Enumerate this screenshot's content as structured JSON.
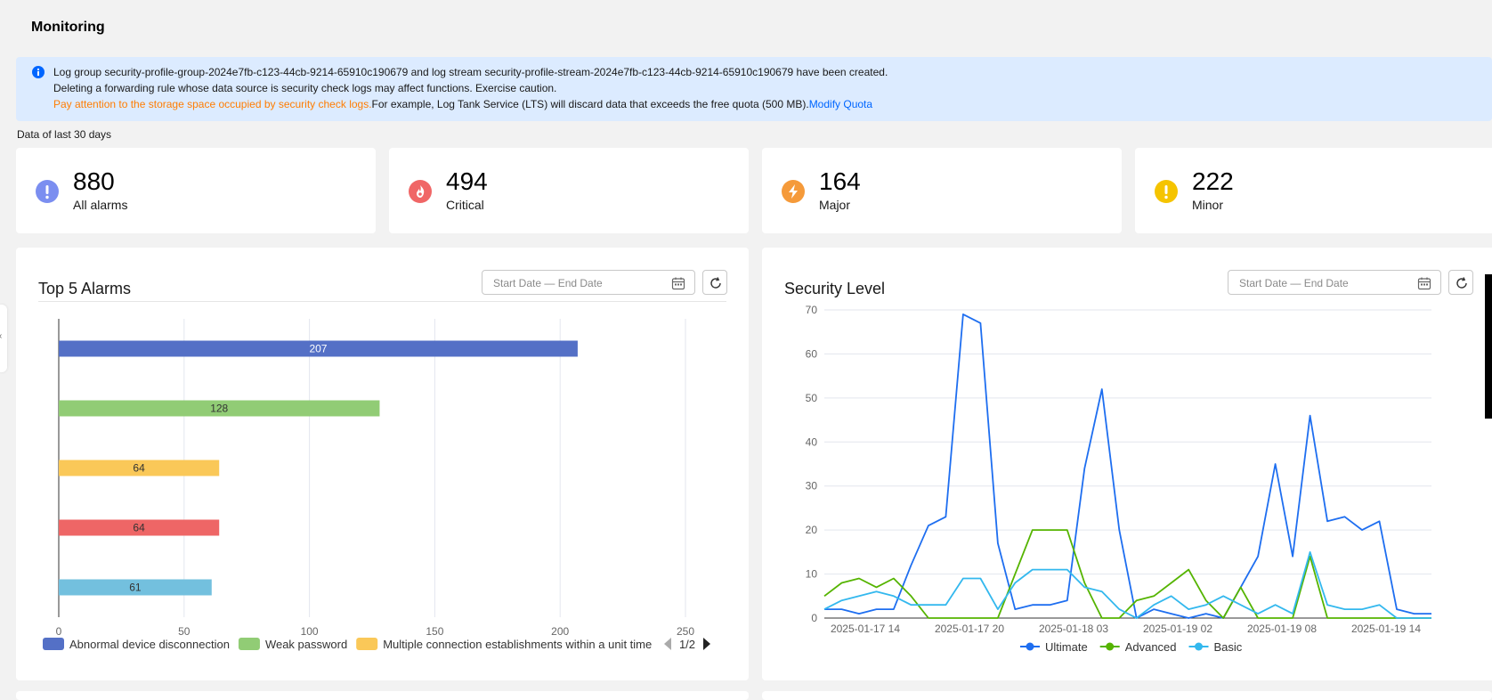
{
  "page": {
    "title": "Monitoring"
  },
  "notice": {
    "line1": "Log group security-profile-group-2024e7fb-c123-44cb-9214-65910c190679 and log stream security-profile-stream-2024e7fb-c123-44cb-9214-65910c190679 have been created.",
    "line2": "Deleting a forwarding rule whose data source is security check logs may affect functions. Exercise caution.",
    "warning": "Pay attention to the storage space occupied by security check logs.",
    "line3": "For example, Log Tank Service (LTS) will discard data that exceeds the free quota (500 MB).",
    "link": "Modify Quota",
    "icon": "info-icon"
  },
  "range_label": "Data of last 30 days",
  "stats": [
    {
      "value": "880",
      "label": "All alarms",
      "icon": "exclamation-icon",
      "color": "#7b8ef0"
    },
    {
      "value": "494",
      "label": "Critical",
      "icon": "flame-icon",
      "color": "#f06666"
    },
    {
      "value": "164",
      "label": "Major",
      "icon": "lightning-icon",
      "color": "#f59a3a"
    },
    {
      "value": "222",
      "label": "Minor",
      "icon": "exclamation-icon",
      "color": "#f5c400"
    }
  ],
  "top_alarms": {
    "title": "Top 5 Alarms",
    "date_placeholder": "Start Date — End Date",
    "pager": "1/2"
  },
  "security_level": {
    "title": "Security Level",
    "date_placeholder": "Start Date — End Date"
  },
  "chart_data": [
    {
      "type": "bar",
      "orientation": "horizontal",
      "title": "Top 5 Alarms",
      "categories": [
        "Abnormal device disconnection",
        "Weak password",
        "Multiple connection establishments within a unit time",
        "",
        ""
      ],
      "values": [
        207,
        128,
        64,
        64,
        61
      ],
      "colors": [
        "#5470c6",
        "#91cc75",
        "#fac858",
        "#ee6666",
        "#73c0de"
      ],
      "legend": [
        "Abnormal device disconnection",
        "Weak password",
        "Multiple connection establishments within a unit time"
      ],
      "xlim": [
        0,
        250
      ],
      "xticks": [
        0,
        50,
        100,
        150,
        200,
        250
      ],
      "grid": true,
      "legend_position": "bottom"
    },
    {
      "type": "line",
      "title": "Security Level",
      "x_ticks": [
        "2025-01-17 14",
        "2025-01-17 20",
        "2025-01-18 03",
        "2025-01-19 02",
        "2025-01-19 08",
        "2025-01-19 14"
      ],
      "ylim": [
        0,
        70
      ],
      "yticks": [
        0,
        10,
        20,
        30,
        40,
        50,
        60,
        70
      ],
      "grid": true,
      "legend_position": "bottom",
      "series": [
        {
          "name": "Ultimate",
          "color": "#1e6ef0",
          "values": [
            2,
            2,
            1,
            2,
            2,
            12,
            21,
            23,
            69,
            67,
            17,
            2,
            3,
            3,
            4,
            34,
            52,
            20,
            0,
            2,
            1,
            0,
            1,
            0,
            7,
            14,
            35,
            14,
            46,
            22,
            23,
            20,
            22,
            2,
            1,
            1
          ]
        },
        {
          "name": "Advanced",
          "color": "#55b400",
          "values": [
            5,
            8,
            9,
            7,
            9,
            5,
            0,
            0,
            0,
            0,
            0,
            10,
            20,
            20,
            20,
            8,
            0,
            0,
            4,
            5,
            8,
            11,
            4,
            0,
            7,
            0,
            0,
            0,
            14,
            0,
            0,
            0,
            0,
            0,
            0,
            0
          ]
        },
        {
          "name": "Basic",
          "color": "#33b8ee",
          "values": [
            2,
            4,
            5,
            6,
            5,
            3,
            3,
            3,
            9,
            9,
            2,
            8,
            11,
            11,
            11,
            7,
            6,
            2,
            0,
            3,
            5,
            2,
            3,
            5,
            3,
            1,
            3,
            1,
            15,
            3,
            2,
            2,
            3,
            0,
            0,
            0
          ]
        }
      ]
    }
  ]
}
